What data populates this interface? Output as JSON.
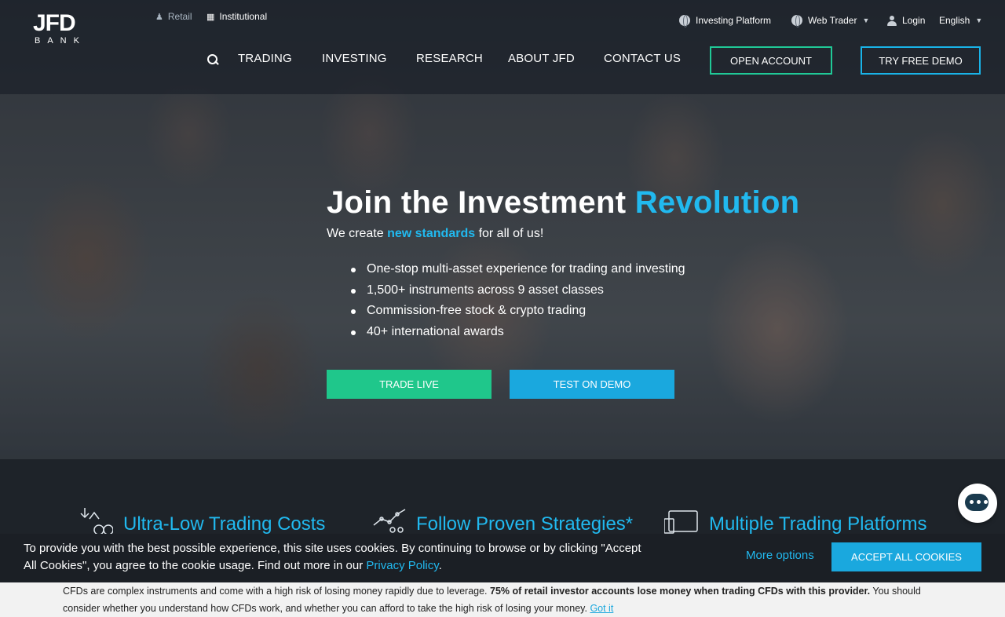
{
  "brand": {
    "logo_top": "JFD",
    "logo_bottom": "BANK"
  },
  "segments": {
    "retail": "Retail",
    "institutional": "Institutional"
  },
  "utility": {
    "investing_platform": "Investing Platform",
    "web_trader": "Web Trader",
    "login": "Login",
    "language": "English"
  },
  "nav": {
    "items": [
      "TRADING",
      "INVESTING",
      "RESEARCH",
      "ABOUT JFD",
      "CONTACT US"
    ],
    "open_account": "OPEN ACCOUNT",
    "try_demo": "TRY FREE DEMO"
  },
  "hero": {
    "headline_main": "Join the Investment",
    "headline_accent": "Revolution",
    "sub_before": "We create",
    "sub_accent": "new standards",
    "sub_after": "for all of us!",
    "bullets": [
      "One-stop multi-asset experience for trading and investing",
      "1,500+ instruments across 9 asset classes",
      "Commission-free stock & crypto trading",
      "40+ international awards"
    ],
    "trade_live": "TRADE LIVE",
    "test_demo": "TEST ON DEMO"
  },
  "features": [
    {
      "title": "Ultra-Low Trading Costs",
      "icon": "cost-icon"
    },
    {
      "title": "Follow Proven Strategies*",
      "icon": "strategy-icon"
    },
    {
      "title": "Multiple Trading Platforms",
      "icon": "platform-icon"
    }
  ],
  "cookie": {
    "text": "To provide you with the best possible experience, this site uses cookies. By continuing to browse or by clicking \"Accept All Cookies\", you agree to the cookie usage. Find out more in our",
    "policy_link": "Privacy Policy",
    "end": ".",
    "more_options": "More options",
    "accept": "ACCEPT ALL COOKIES"
  },
  "risk": {
    "text_a": "CFDs are complex instruments and come with a high risk of losing money rapidly due to leverage.",
    "text_bold": "75% of retail investor accounts lose money when trading CFDs with this provider.",
    "text_b": "You should consider whether you understand how CFDs work, and whether you can afford to take the high risk of losing your money.",
    "got_it": "Got it"
  },
  "colors": {
    "accent_blue": "#21b9ef",
    "accent_green": "#1fc78b",
    "button_blue": "#1aa8de"
  }
}
